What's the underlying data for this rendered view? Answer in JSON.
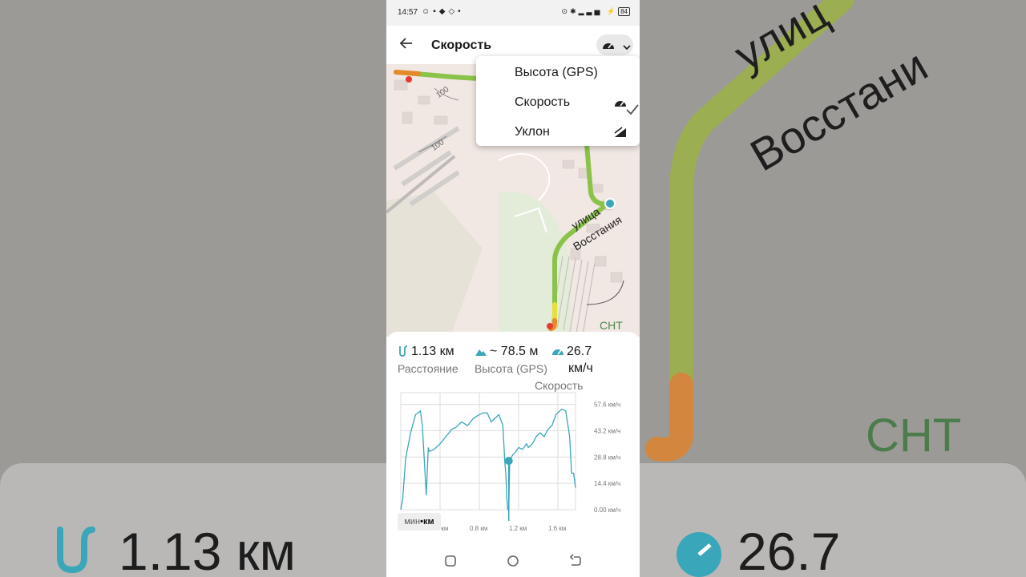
{
  "status_bar": {
    "time": "14:57",
    "battery": "84"
  },
  "app_bar": {
    "title": "Скорость"
  },
  "dropdown": {
    "items": [
      {
        "label": "Высота (GPS)",
        "checked": false,
        "icon": "mountain-icon"
      },
      {
        "label": "Скорость",
        "checked": true,
        "icon": "speedometer-icon"
      },
      {
        "label": "Уклон",
        "checked": false,
        "icon": "slope-icon"
      }
    ]
  },
  "map": {
    "street_line1": "улица",
    "street_line2": "Восстания",
    "contour_labels": [
      "100",
      "100"
    ],
    "place_label": "СНТ"
  },
  "stats": {
    "distance": {
      "value": "1.13 км",
      "label": "Расстояние"
    },
    "altitude": {
      "value": "~ 78.5 м",
      "label": "Высота (GPS)"
    },
    "speed": {
      "value": "26.7",
      "unit": "км/ч",
      "label": "Скорость"
    }
  },
  "unit_toggle": {
    "left": "мин",
    "right": "км"
  },
  "background": {
    "distance": "1.13 км",
    "speed": "26.7",
    "street_line1": "улиц",
    "street_line2": "Восстани",
    "place_label": "СНТ"
  },
  "colors": {
    "accent": "#3aa6b9",
    "route_green": "#8bc34a",
    "route_yellow": "#e6e03a",
    "route_red": "#e53935"
  },
  "chart_data": {
    "type": "line",
    "x_ticks": [
      "0.4 км",
      "0.8 км",
      "1.2 км",
      "1.6 км"
    ],
    "y_ticks": [
      "0.00 км/ч",
      "14.4 км/ч",
      "28.8 км/ч",
      "43.2 км/ч",
      "57.6 км/ч"
    ],
    "x_unit": "km",
    "y_unit": "km/h",
    "xlim": [
      0,
      1.78
    ],
    "ylim": [
      0,
      64
    ],
    "x": [
      0.0,
      0.02,
      0.05,
      0.1,
      0.15,
      0.2,
      0.22,
      0.26,
      0.28,
      0.29,
      0.3,
      0.34,
      0.4,
      0.46,
      0.52,
      0.56,
      0.62,
      0.68,
      0.74,
      0.8,
      0.84,
      0.88,
      0.92,
      0.96,
      1.0,
      1.04,
      1.06,
      1.07,
      1.08,
      1.09,
      1.1,
      1.11,
      1.12,
      1.14,
      1.16,
      1.2,
      1.24,
      1.28,
      1.3,
      1.34,
      1.38,
      1.42,
      1.46,
      1.5,
      1.54,
      1.58,
      1.62,
      1.64,
      1.68,
      1.72,
      1.74,
      1.76,
      1.77,
      1.78
    ],
    "y": [
      0,
      6,
      28,
      42,
      52,
      54,
      46,
      8,
      34,
      32,
      32,
      33,
      36,
      40,
      44,
      45,
      48,
      46,
      50,
      52,
      53,
      53,
      48,
      50,
      52,
      46,
      26,
      20,
      6,
      0,
      0,
      26,
      28,
      30,
      31,
      34,
      33,
      36,
      34,
      36,
      40,
      42,
      40,
      44,
      46,
      52,
      54,
      55,
      54,
      40,
      20,
      20,
      16,
      12
    ]
  },
  "chart_marker": {
    "x": 1.1,
    "y": 26.7
  }
}
